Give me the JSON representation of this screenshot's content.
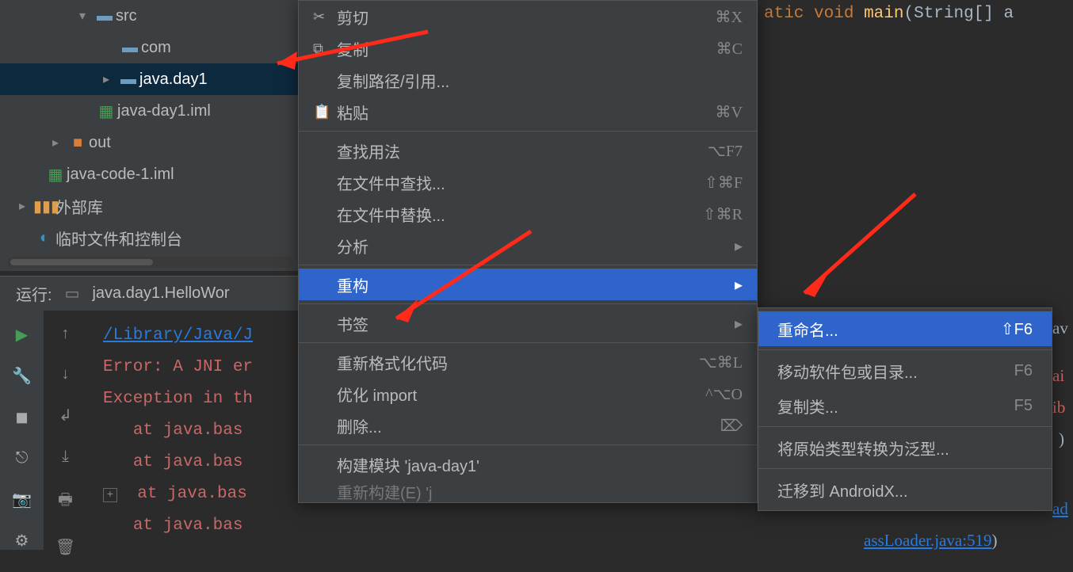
{
  "tree": {
    "src_label": "src",
    "com_label": "com",
    "javaday1_label": "java.day1",
    "iml1_label": "java-day1.iml",
    "out_label": "out",
    "iml2_label": "java-code-1.iml",
    "ext_libs_label": "外部库",
    "scratches_label": "临时文件和控制台"
  },
  "run": {
    "label": "运行:",
    "config": "java.day1.HelloWor"
  },
  "console": {
    "path": "/Library/Java/J",
    "line1": "Error: A JNI er",
    "line2": "Exception in th",
    "at": "at java.bas",
    "tail1": "assLoader.java:519",
    "tail2": ")"
  },
  "editor": {
    "kw1": "atic",
    "kw2": "void",
    "fn": "main",
    "args": "(String[] a",
    "frag_av": "av",
    "frag_ai": "ai",
    "frag_ib": "ib",
    "frag_paren": ")",
    "frag_ad": "ad"
  },
  "menu": {
    "cut": "剪切",
    "copy": "复制",
    "copy_path": "复制路径/引用...",
    "paste": "粘贴",
    "find_usages": "查找用法",
    "find_in_files": "在文件中查找...",
    "replace_in_files": "在文件中替换...",
    "analyze": "分析",
    "refactor": "重构",
    "bookmarks": "书签",
    "reformat": "重新格式化代码",
    "optimize_imports": "优化 import",
    "delete": "删除...",
    "build_module": "构建模块 'java-day1'",
    "rebuild": "重新构建(E) 'j",
    "sc_cut": "⌘X",
    "sc_copy": "⌘C",
    "sc_paste": "⌘V",
    "sc_find_usages": "⌥F7",
    "sc_find_in_files": "⇧⌘F",
    "sc_replace_in_files": "⇧⌘R",
    "sc_reformat": "⌥⌘L",
    "sc_optimize": "^⌥O",
    "sc_delete": "⌦"
  },
  "submenu": {
    "rename": "重命名...",
    "move": "移动软件包或目录...",
    "copy_class": "复制类...",
    "generify": "将原始类型转换为泛型...",
    "migrate_androidx": "迁移到 AndroidX...",
    "sc_rename": "⇧F6",
    "sc_move": "F6",
    "sc_copy_class": "F5"
  }
}
